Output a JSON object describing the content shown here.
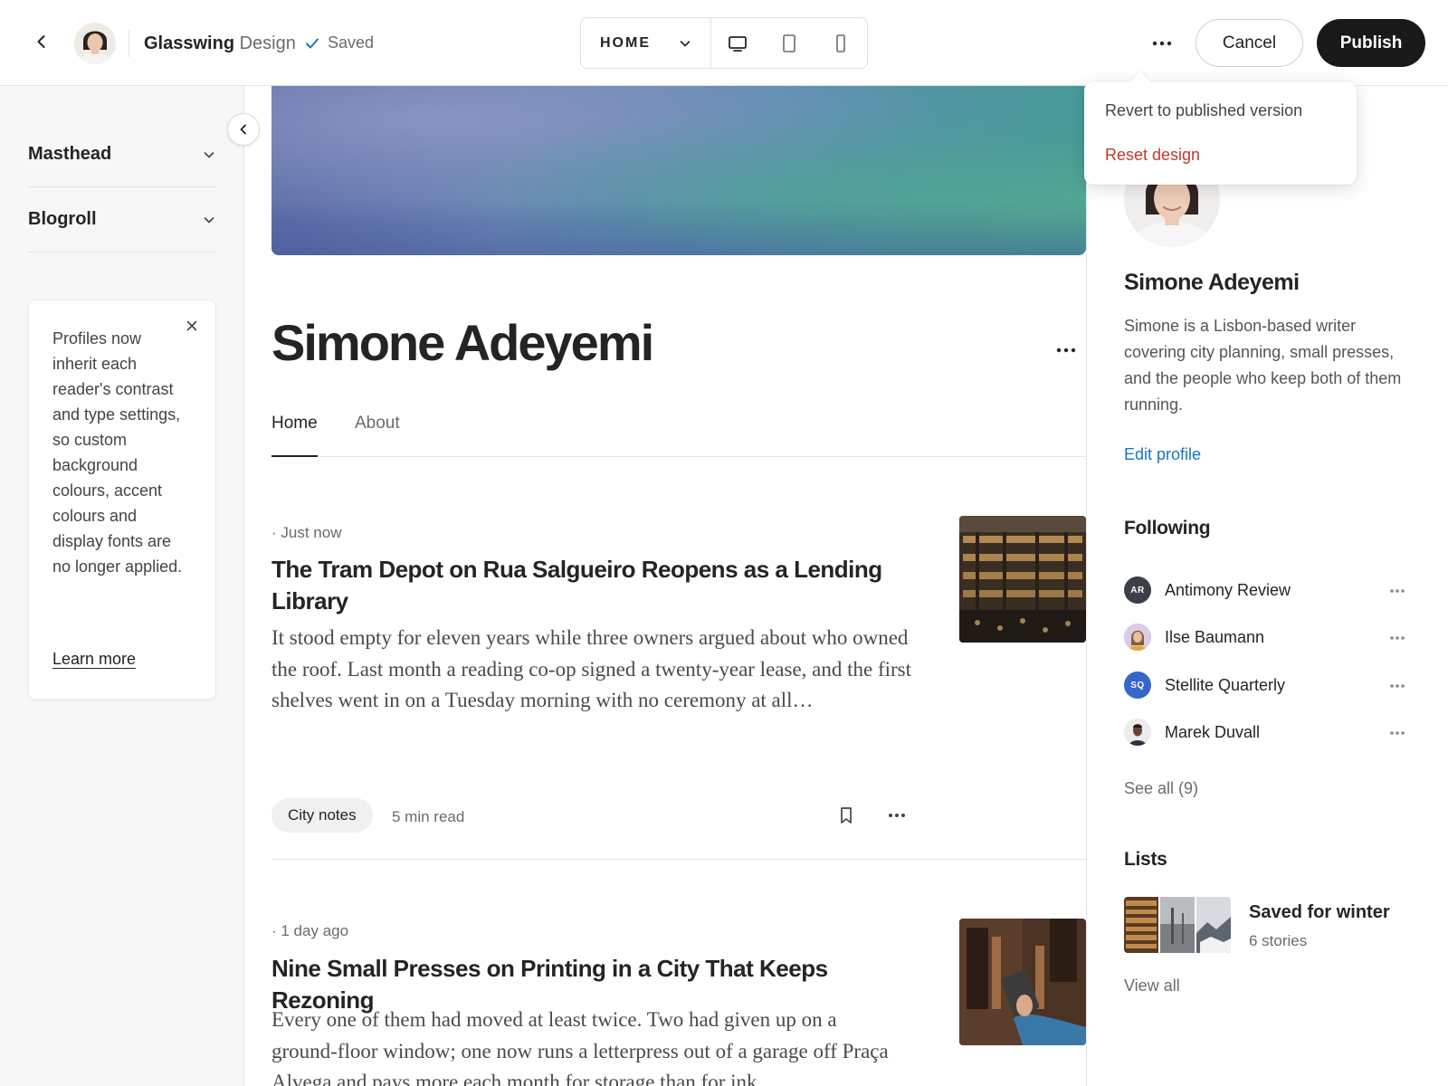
{
  "topbar": {
    "brand_name": "Glasswing",
    "brand_sub": "Design",
    "saved_label": "Saved",
    "view_select": "HOME",
    "cancel_label": "Cancel",
    "publish_label": "Publish"
  },
  "menu": {
    "revert_label": "Revert to published version",
    "reset_label": "Reset design"
  },
  "left_panel": {
    "sections": [
      {
        "label": "Masthead"
      },
      {
        "label": "Blogroll"
      }
    ],
    "notice": {
      "text": "Profiles now inherit each reader's contrast and type settings, so custom background colours, accent colours and display fonts are no longer applied.",
      "link": "Learn more"
    }
  },
  "profile": {
    "name": "Simone Adeyemi",
    "tabs": [
      {
        "label": "Home",
        "active": true
      },
      {
        "label": "About",
        "active": false
      }
    ]
  },
  "posts": [
    {
      "meta": "· Just now",
      "title": "The Tram Depot on Rua Salgueiro Reopens as a Lending Library",
      "excerpt": "It stood empty for eleven years while three owners argued about who owned the roof. Last month a reading co-op signed a twenty-year lease, and the first shelves went in on a Tuesday morning with no ceremony at all…",
      "tag": "City notes",
      "read_time": "5 min read"
    },
    {
      "meta": "· 1 day ago",
      "title": "Nine Small Presses on Printing in a City That Keeps Rezoning",
      "excerpt": "Every one of them had moved at least twice. Two had given up on a ground-floor window; one now runs a letterpress out of a garage off Praça Alvega and pays more each month for storage than for ink."
    }
  ],
  "sidebar": {
    "name": "Simone Adeyemi",
    "bio": "Simone is a Lisbon-based writer covering city planning, small presses, and the people who keep both of them running.",
    "edit_profile": "Edit profile",
    "following_heading": "Following",
    "following": [
      {
        "initials": "AR",
        "name": "Antimony Review",
        "color": "#3a3f4a"
      },
      {
        "initials": "",
        "name": "Ilse Baumann",
        "color": "#b99bd0"
      },
      {
        "initials": "SQ",
        "name": "Stellite Quarterly",
        "color": "#3566c9"
      },
      {
        "initials": "",
        "name": "Marek Duvall",
        "color": "#e9e9e9"
      }
    ],
    "see_all": "See all (9)",
    "lists_heading": "Lists",
    "list": {
      "title": "Saved for winter",
      "count": "6 stories"
    },
    "view_all": "View all"
  },
  "colors": {
    "accent_link": "#1a73c7",
    "danger": "#c0392b",
    "publish_bg": "#191919"
  }
}
